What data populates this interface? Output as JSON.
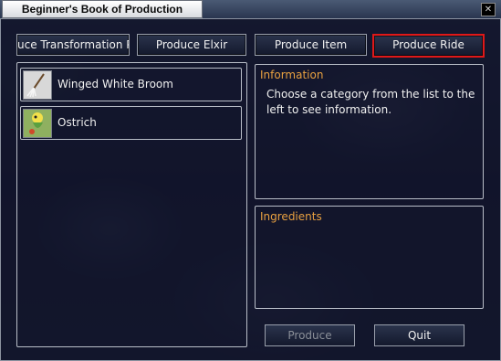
{
  "window": {
    "title": "Beginner's Book of Production",
    "close_glyph": "✕"
  },
  "tabs": [
    {
      "label": "uce Transformation Po"
    },
    {
      "label": "Produce Elxir"
    },
    {
      "label": "Produce Item"
    },
    {
      "label": "Produce Ride",
      "active": true
    }
  ],
  "recipes": [
    {
      "label": "Winged White Broom",
      "icon": "broom-icon"
    },
    {
      "label": "Ostrich",
      "icon": "ostrich-icon"
    }
  ],
  "information": {
    "heading": "Information",
    "text": "Choose a category from the list to the left to see information."
  },
  "ingredients": {
    "heading": "Ingredients"
  },
  "buttons": {
    "produce": "Produce",
    "quit": "Quit"
  },
  "colors": {
    "active_tab_border": "#e01818",
    "heading": "#e8a040"
  }
}
